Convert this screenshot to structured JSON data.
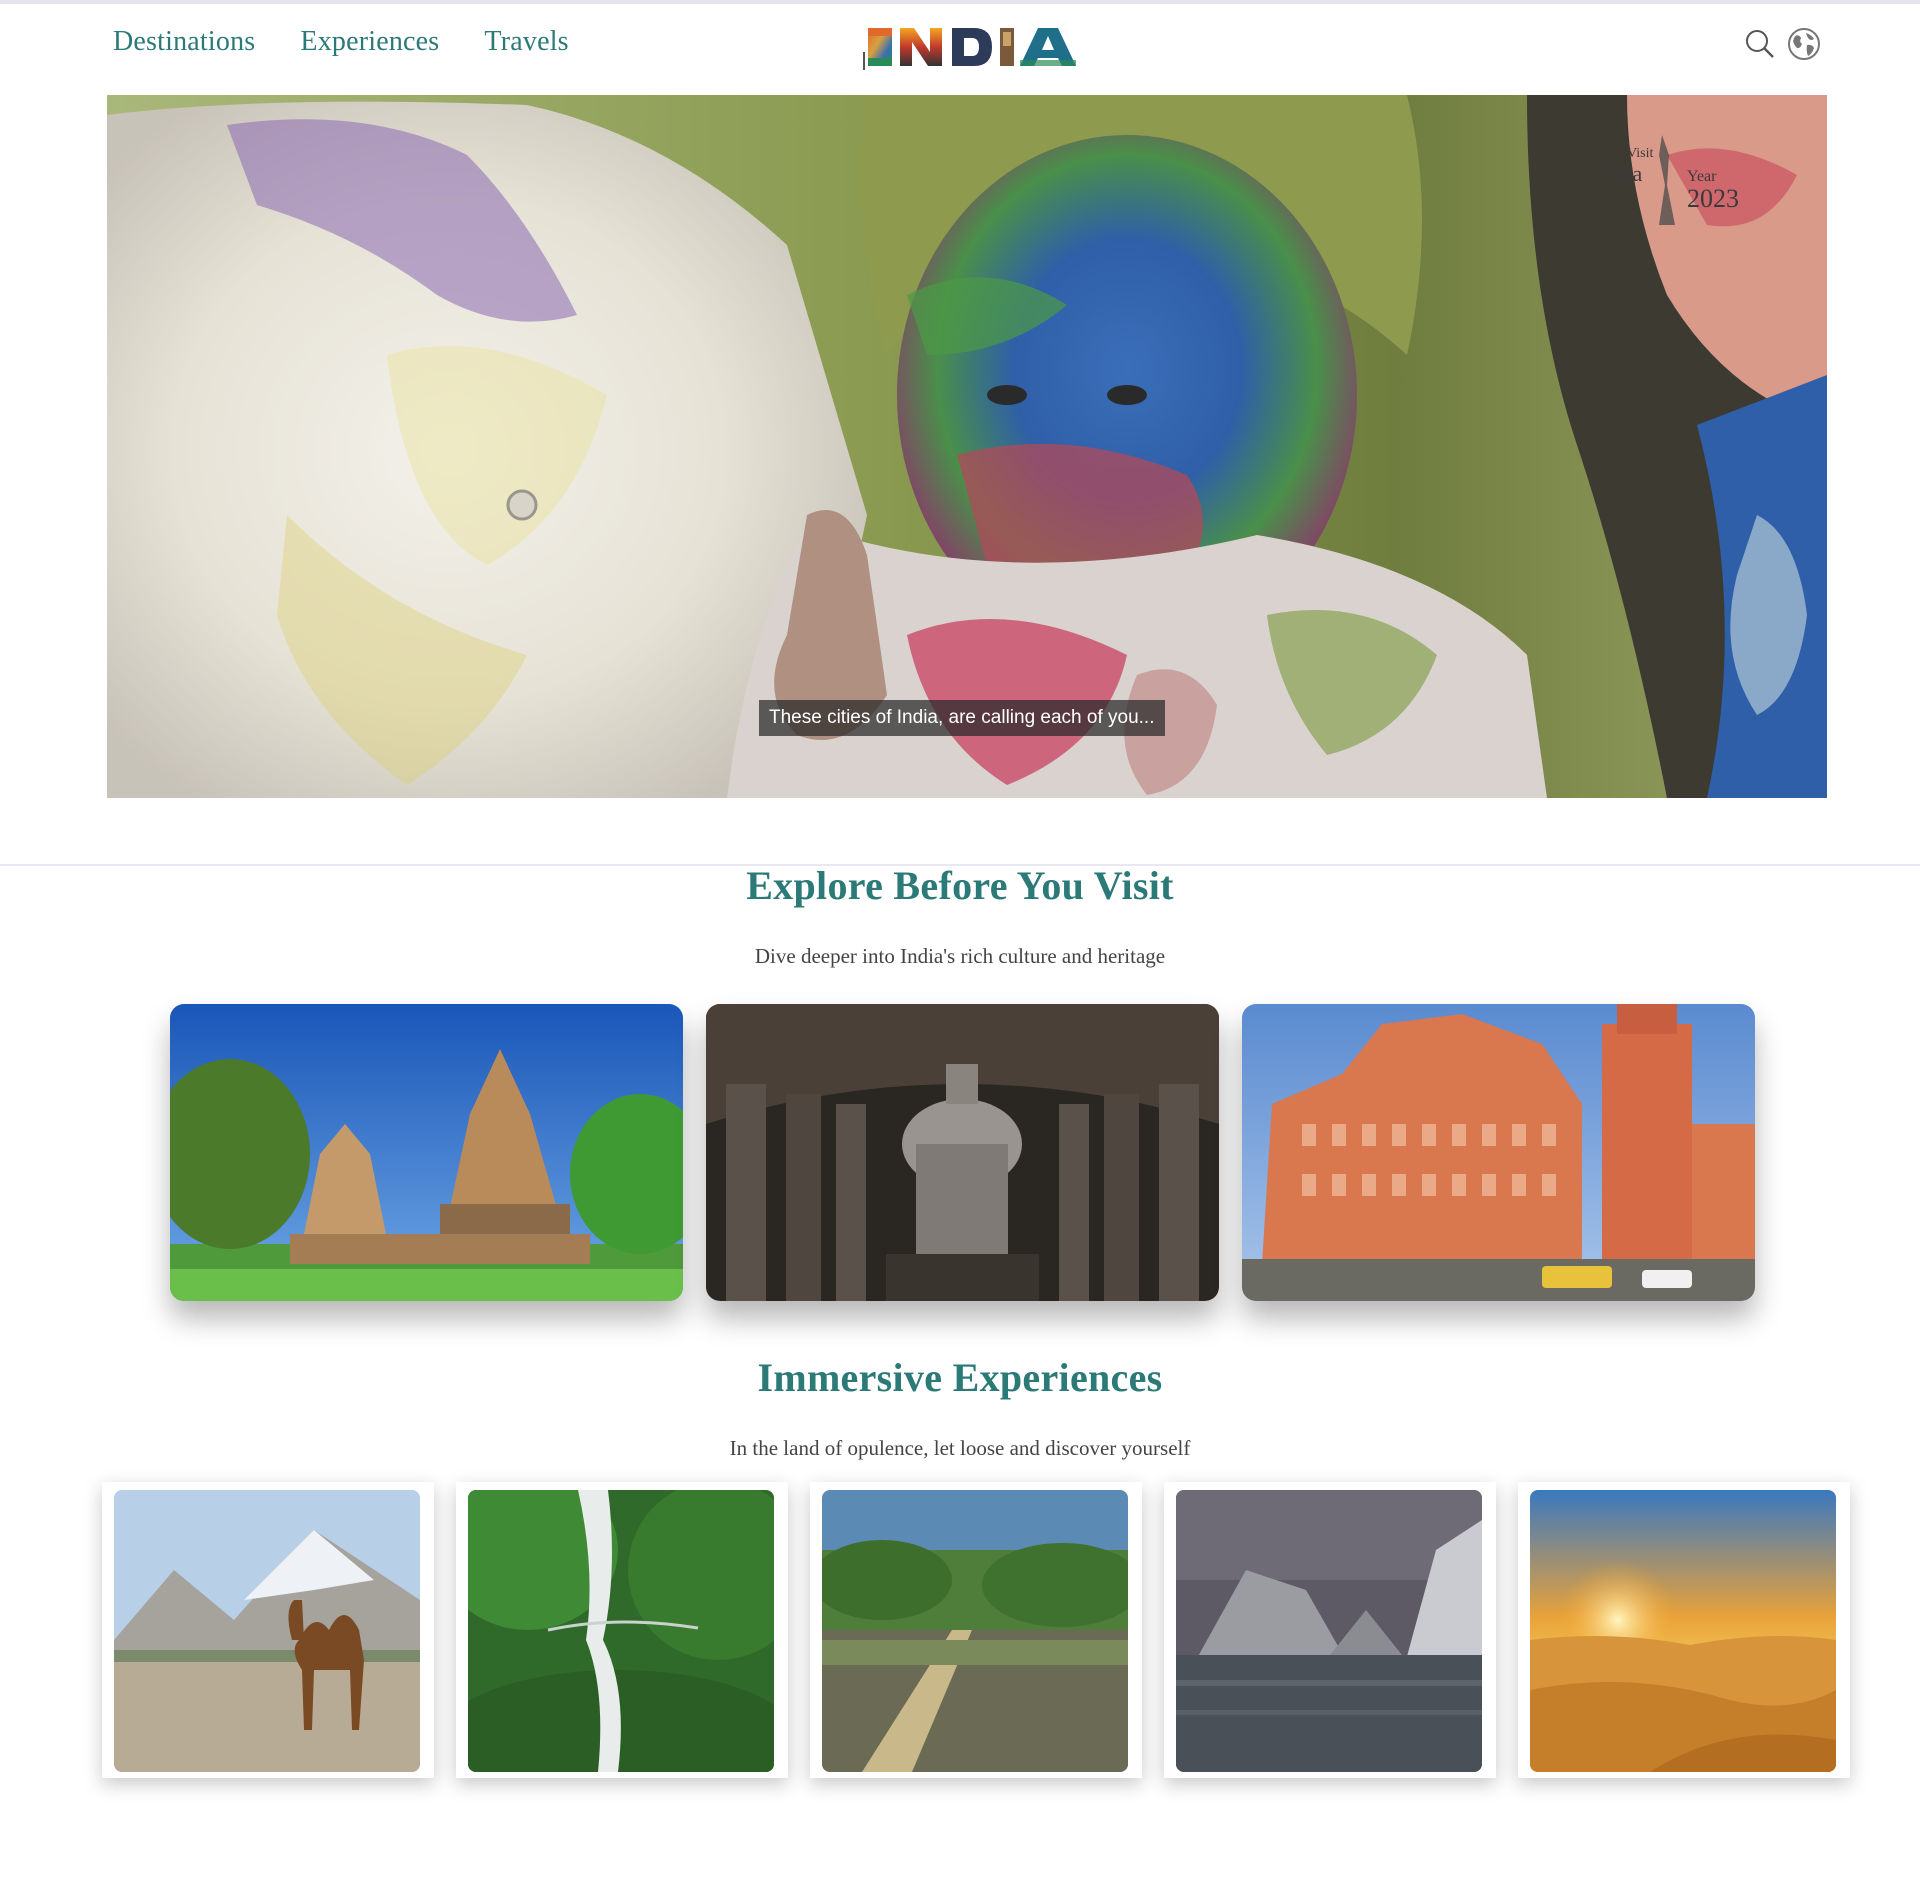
{
  "header": {
    "nav": [
      "Destinations",
      "Experiences",
      "Travels"
    ],
    "logo_text": "INDIA",
    "icons": [
      "search-icon",
      "globe-icon"
    ]
  },
  "hero": {
    "badge": {
      "line1": "Visit",
      "line2": "India",
      "line3": "Year",
      "year": "2023"
    },
    "caption": "These cities of India, are calling each of you..."
  },
  "explore": {
    "title": "Explore Before You Visit",
    "subtitle": "Dive deeper into India's rich culture and heritage",
    "cards": [
      "khajuraho-temples-image",
      "ajanta-cave-interior-image",
      "hawa-mahal-image"
    ]
  },
  "experiences": {
    "title": "Immersive Experiences",
    "subtitle": "In the land of opulence, let loose and discover yourself",
    "cards": [
      "camel-valley-image",
      "waterfall-forest-image",
      "mangrove-boardwalk-image",
      "marble-gorge-river-image",
      "desert-sunset-image"
    ]
  },
  "colors": {
    "accent": "#2b7a78",
    "caption_bg": "#3a3a3a"
  }
}
